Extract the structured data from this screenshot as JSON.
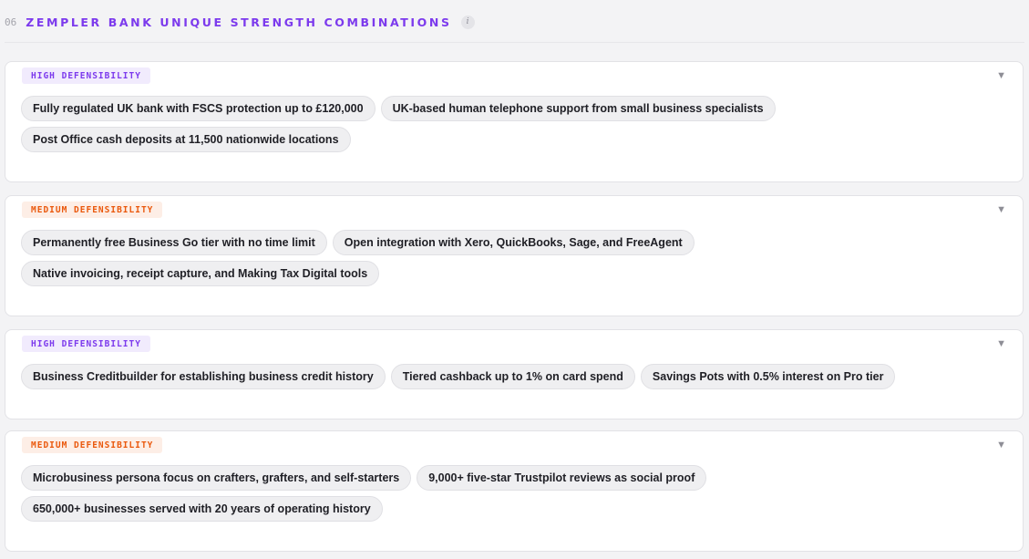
{
  "section": {
    "number": "06",
    "title": "ZEMPLER BANK UNIQUE STRENGTH COMBINATIONS",
    "info_icon": "i"
  },
  "chevron_glyph": "▼",
  "colors": {
    "accent_purple": "#7c3aed",
    "accent_orange": "#ea580c"
  },
  "groups": [
    {
      "badge": "HIGH DEFENSIBILITY",
      "level": "high",
      "rows": [
        [
          "Fully regulated UK bank with FSCS protection up to £120,000",
          "UK-based human telephone support from small business specialists"
        ],
        [
          "Post Office cash deposits at 11,500 nationwide locations"
        ]
      ]
    },
    {
      "badge": "MEDIUM DEFENSIBILITY",
      "level": "medium",
      "rows": [
        [
          "Permanently free Business Go tier with no time limit",
          "Open integration with Xero, QuickBooks, Sage, and FreeAgent"
        ],
        [
          "Native invoicing, receipt capture, and Making Tax Digital tools"
        ]
      ]
    },
    {
      "badge": "HIGH DEFENSIBILITY",
      "level": "high",
      "rows": [
        [
          "Business Creditbuilder for establishing business credit history",
          "Tiered cashback up to 1% on card spend",
          "Savings Pots with 0.5% interest on Pro tier"
        ]
      ]
    },
    {
      "badge": "MEDIUM DEFENSIBILITY",
      "level": "medium",
      "rows": [
        [
          "Microbusiness persona focus on crafters, grafters, and self-starters",
          "9,000+ five-star Trustpilot reviews as social proof"
        ],
        [
          "650,000+ businesses served with 20 years of operating history"
        ]
      ]
    }
  ]
}
